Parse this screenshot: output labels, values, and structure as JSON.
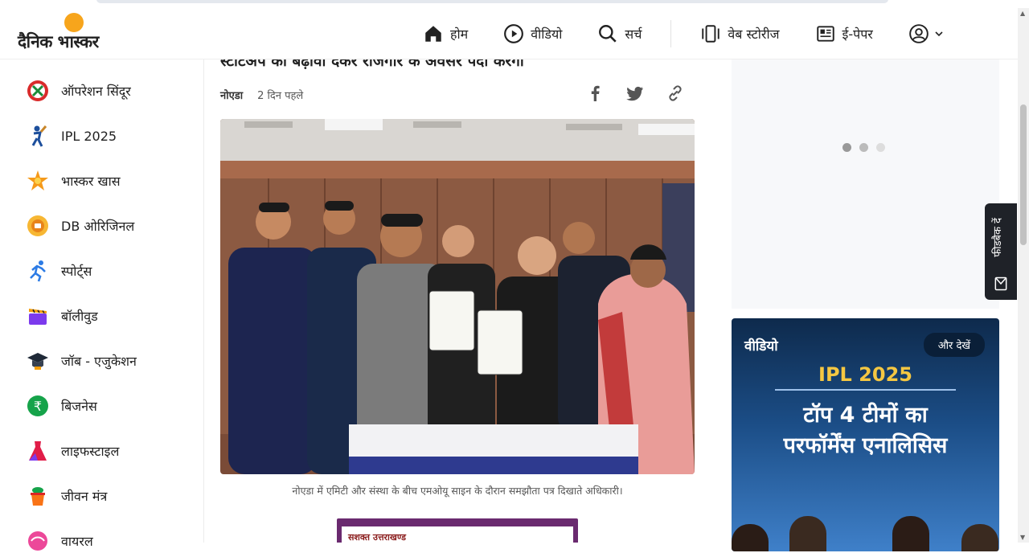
{
  "header": {
    "logo_text": "दैनिक भास्कर",
    "nav": [
      {
        "label": "होम",
        "icon": "home-icon"
      },
      {
        "label": "वीडियो",
        "icon": "play-circle-icon"
      },
      {
        "label": "सर्च",
        "icon": "search-icon"
      },
      {
        "label": "वेब स्टोरीज",
        "icon": "web-stories-icon"
      },
      {
        "label": "ई-पेपर",
        "icon": "newspaper-icon"
      }
    ],
    "profile_icon": "user-circle-icon"
  },
  "sidebar": {
    "items": [
      {
        "label": "ऑपरेशन सिंदूर",
        "icon": "operation-sindoor-icon"
      },
      {
        "label": "IPL 2025",
        "icon": "cricket-batsman-icon"
      },
      {
        "label": "भास्कर खास",
        "icon": "star-burst-icon"
      },
      {
        "label": "DB ओरिजिनल",
        "icon": "db-original-icon"
      },
      {
        "label": "स्पोर्ट्स",
        "icon": "runner-icon"
      },
      {
        "label": "बॉलीवुड",
        "icon": "clapperboard-icon"
      },
      {
        "label": "जॉब - एजुकेशन",
        "icon": "graduation-cap-icon"
      },
      {
        "label": "बिजनेस",
        "icon": "rupee-icon"
      },
      {
        "label": "लाइफस्टाइल",
        "icon": "dress-icon"
      },
      {
        "label": "जीवन मंत्र",
        "icon": "kalash-icon"
      },
      {
        "label": "वायरल",
        "icon": "viral-icon"
      }
    ]
  },
  "article": {
    "title_cut": "स्टार्टअप को बढ़ावा देकर रोजगार के अवसर पैदा करेगा",
    "location": "नोएडा",
    "time": "2 दिन पहले",
    "share_icons": [
      "facebook-icon",
      "twitter-icon",
      "link-icon"
    ],
    "caption": "नोएडा में एमिटी और संस्था के बीच एमओयू साइन के दौरान समझौता पत्र दिखाते अधिकारी।",
    "ad_text": "सशक्त उत्तराखण्ड"
  },
  "right": {
    "video_title": "वीडियो",
    "more_label": "और देखें",
    "ipl": "IPL 2025",
    "headline_line1": "टॉप 4 टीमों का",
    "headline_line2": "परफॉर्मेंस एनालिसिस"
  },
  "feedback": {
    "label": "फीडबैक दें",
    "icon": "mail-icon"
  }
}
